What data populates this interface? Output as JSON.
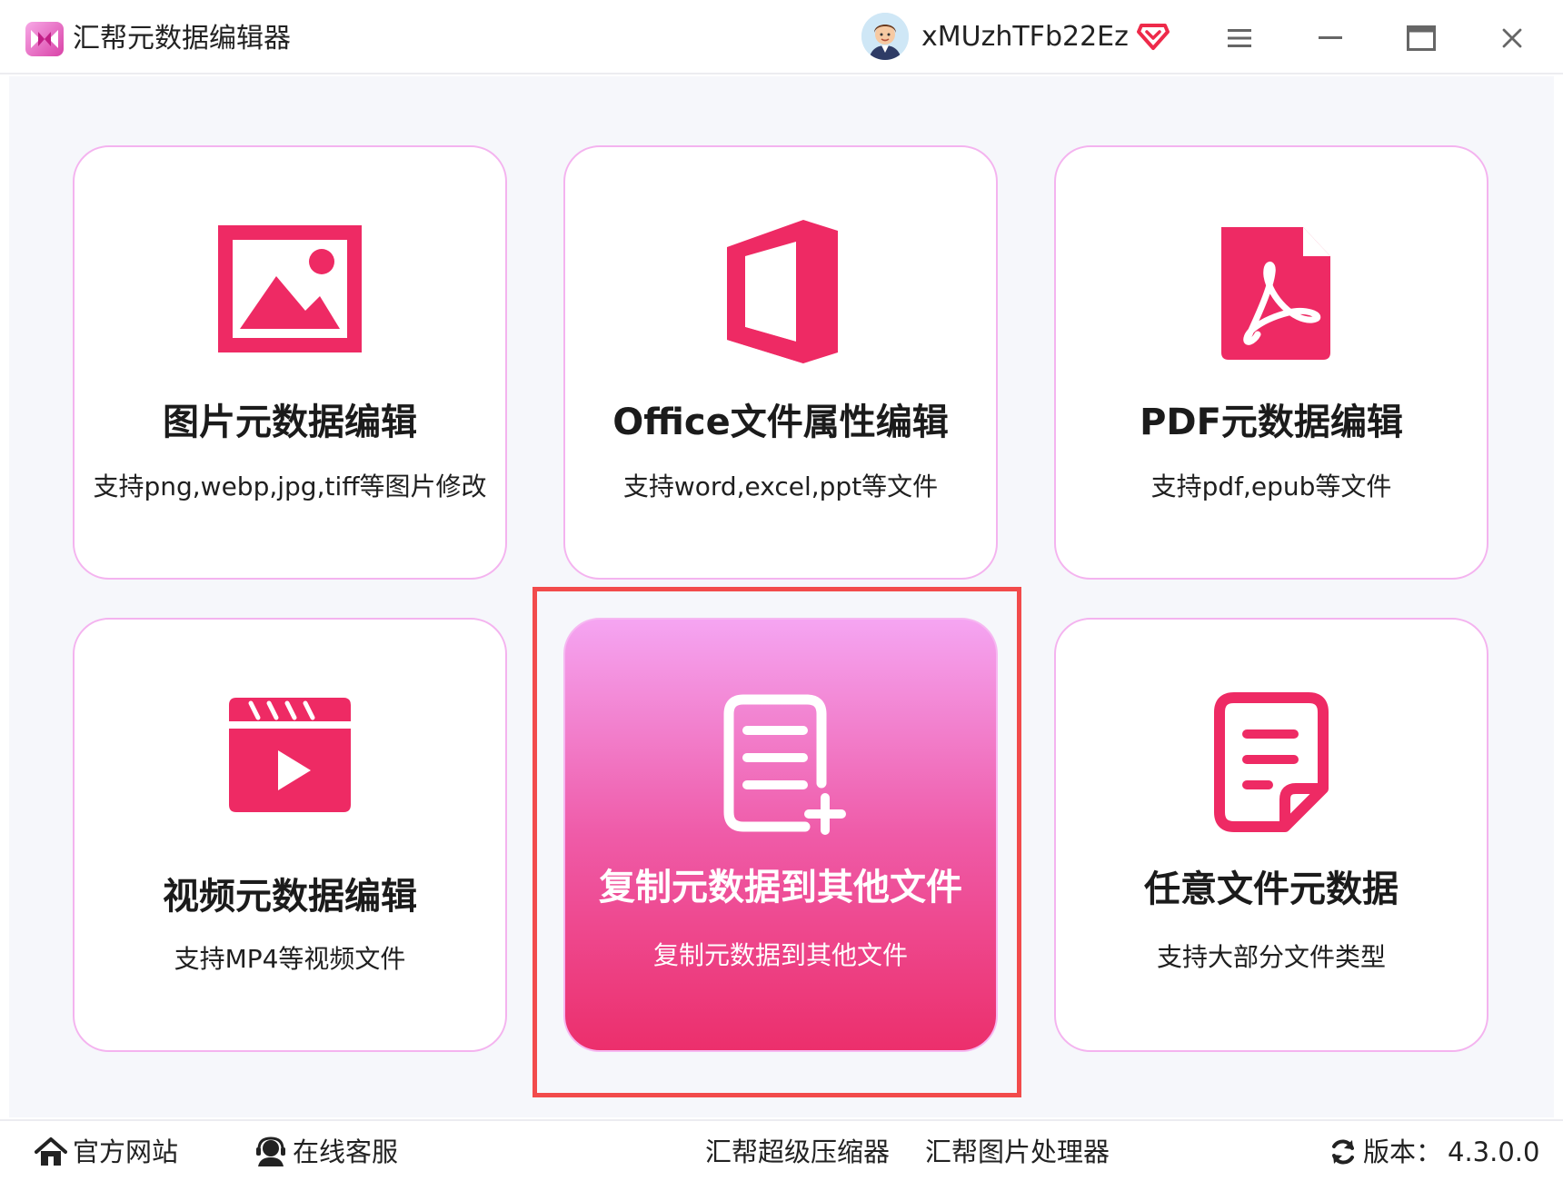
{
  "app": {
    "title": "汇帮元数据编辑器",
    "accent_color": "#ee2a64",
    "highlight_color": "#f24b4b"
  },
  "user": {
    "name": "xMUzhTFb22Ez",
    "avatar_icon": "avatar-icon",
    "vip_icon": "vip-diamond-icon"
  },
  "window_controls": [
    "menu-icon",
    "minimize-icon",
    "maximize-icon",
    "close-icon"
  ],
  "cards": [
    {
      "title": "图片元数据编辑",
      "desc": "支持png,webp,jpg,tiff等图片修改",
      "icon": "image-icon"
    },
    {
      "title": "Office文件属性编辑",
      "desc": "支持word,excel,ppt等文件",
      "icon": "office-icon"
    },
    {
      "title": "PDF元数据编辑",
      "desc": "支持pdf,epub等文件",
      "icon": "pdf-icon"
    },
    {
      "title": "视频元数据编辑",
      "desc": "支持MP4等视频文件",
      "icon": "video-icon"
    },
    {
      "title": "复制元数据到其他文件",
      "desc": "复制元数据到其他文件",
      "icon": "copy-document-icon",
      "active": true
    },
    {
      "title": "任意文件元数据",
      "desc": "支持大部分文件类型",
      "icon": "document-icon"
    }
  ],
  "footer": {
    "website": "官方网站",
    "support": "在线客服",
    "compressor": "汇帮超级压缩器",
    "image_processor": "汇帮图片处理器",
    "version_label": "版本：",
    "version": "4.3.0.0"
  }
}
